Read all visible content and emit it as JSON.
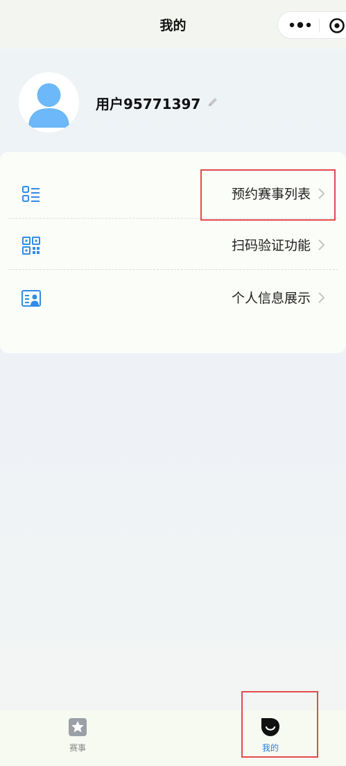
{
  "header": {
    "title": "我的"
  },
  "capsule": {
    "more_icon": "more-dots-icon",
    "target_icon": "target-icon"
  },
  "profile": {
    "avatar_icon": "user-avatar-icon",
    "username": "用户95771397",
    "edit_icon": "pencil-icon"
  },
  "menu": {
    "items": [
      {
        "label": "预约赛事列表",
        "icon": "list-icon",
        "highlighted": true
      },
      {
        "label": "扫码验证功能",
        "icon": "qr-code-icon",
        "highlighted": false
      },
      {
        "label": "个人信息展示",
        "icon": "id-card-icon",
        "highlighted": false
      }
    ]
  },
  "tabbar": {
    "items": [
      {
        "label": "赛事",
        "icon": "star-badge-icon",
        "active": false
      },
      {
        "label": "我的",
        "icon": "smile-icon",
        "active": true,
        "highlighted": true
      }
    ]
  },
  "colors": {
    "accent": "#2a7de1",
    "icon_blue": "#2f8be6",
    "highlight": "#e5484d",
    "avatar": "#6cb8f8"
  }
}
